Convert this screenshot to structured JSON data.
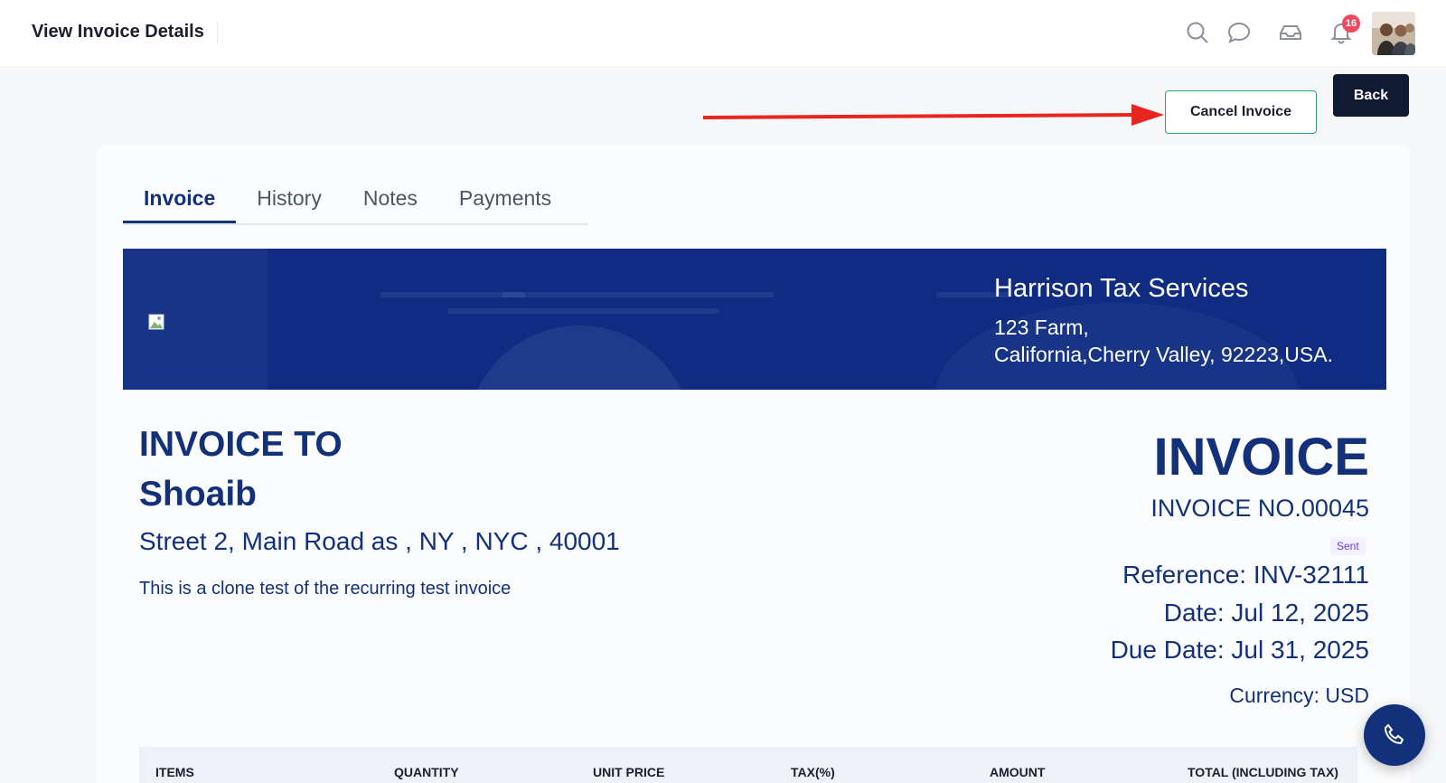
{
  "header": {
    "title": "View Invoice Details",
    "notification_count": "16",
    "icons": [
      "search-icon",
      "chat-icon",
      "inbox-icon",
      "bell-icon"
    ]
  },
  "actions": {
    "cancel_label": "Cancel Invoice",
    "back_label": "Back"
  },
  "tabs": [
    {
      "label": "Invoice",
      "active": true
    },
    {
      "label": "History",
      "active": false
    },
    {
      "label": "Notes",
      "active": false
    },
    {
      "label": "Payments",
      "active": false
    }
  ],
  "company": {
    "name": "Harrison Tax Services",
    "address_line1": "123 Farm,",
    "address_line2": "California,Cherry Valley, 92223,USA."
  },
  "invoice_to": {
    "heading": "INVOICE TO",
    "name": "Shoaib",
    "address": "Street 2, Main Road as , NY , NYC , 40001",
    "note": "This is a clone test of the recurring test invoice"
  },
  "invoice": {
    "heading": "INVOICE",
    "number": "INVOICE NO.00045",
    "status": "Sent",
    "reference": "Reference: INV-32111",
    "date": "Date: Jul 12, 2025",
    "due_date": "Due Date: Jul 31, 2025",
    "currency": "Currency: USD"
  },
  "table": {
    "columns": [
      "ITEMS",
      "QUANTITY",
      "UNIT PRICE",
      "TAX(%)",
      "AMOUNT",
      "TOTAL (INCLUDING TAX)"
    ]
  },
  "colors": {
    "primary": "#13317a",
    "banner": "#0f2c82",
    "accent_border": "#2fa36b",
    "arrow": "#e8251e",
    "badge": "#f0485f"
  }
}
